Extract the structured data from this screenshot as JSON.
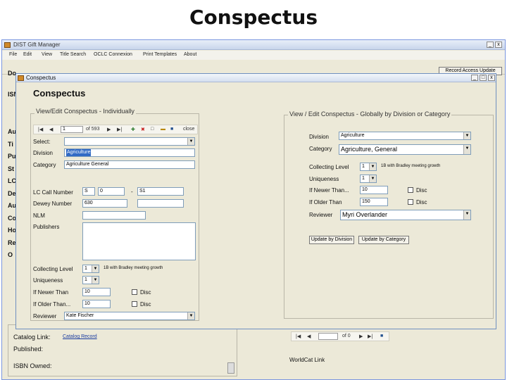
{
  "slide_title": "Conspectus",
  "back_window": {
    "title": "DIST Gift Manager",
    "menu": [
      "File",
      "Edit",
      "View",
      "Title Search",
      "OCLC Connexion",
      "Print Templates",
      "About"
    ],
    "toolbar_btn": "Record Access Update",
    "side_letters": [
      "Do",
      "ISN",
      "Au",
      "Ti",
      "Pu",
      "St",
      "LC",
      "De",
      "Au",
      "Co",
      "Ho",
      "Re",
      "O"
    ],
    "catalog_link_label": "Catalog Link:",
    "catalog_link_value": "Catalog Record",
    "published_label": "Published:",
    "isbn_owned_label": "ISBN Owned:",
    "worldcat_label": "WorldCat Link",
    "nav_of": "of 0"
  },
  "dialog": {
    "title": "Conspectus",
    "heading": "Conspectus",
    "left_group": {
      "label": "View/Edit Conspectus - Individually",
      "nav_position": "1",
      "nav_count": "of 593",
      "nav_close": "close",
      "select_label": "Select:",
      "division_label": "Division",
      "division_value": "Agriculture",
      "category_label": "Category",
      "category_value": "Agriculture General",
      "lc_label": "LC Call Number",
      "lc_from_letter": "S",
      "lc_from_num": "0",
      "lc_dash": "-",
      "lc_to": "S1",
      "dewey_label": "Dewey Number",
      "dewey_value": "630",
      "nlm_label": "NLM",
      "pub_label": "Publishers",
      "collect_label": "Collecting Level",
      "collect_value": "1",
      "collect_desc": "1B with Bradley meeting growth",
      "unique_label": "Uniqueness",
      "unique_value": "1",
      "newer_label": "If Newer Than",
      "newer_value": "10",
      "newer_chk": "Disc",
      "older_label": "If Older Than...",
      "older_value": "10",
      "older_chk": "Disc",
      "reviewer_label": "Reviewer",
      "reviewer_value": "Kate Fischer"
    },
    "right_group": {
      "label": "View / Edit Conspectus - Globally by Division or Category",
      "division_label": "Division",
      "division_value": "Agriculture",
      "category_label": "Category",
      "category_value": "Agriculture, General",
      "collect_label": "Collecting Level",
      "collect_value": "1",
      "collect_desc": "1B with Bradley meeting growth",
      "unique_label": "Uniqueness",
      "unique_value": "1",
      "newer_label": "If Newer Than...",
      "newer_value": "10",
      "newer_chk": "Disc",
      "older_label": "If Older Than",
      "older_value": "150",
      "older_chk": "Disc",
      "reviewer_label": "Reviewer",
      "reviewer_value": "Myri Overlander",
      "btn_division": "Update by Division",
      "btn_category": "Update by Category"
    }
  }
}
